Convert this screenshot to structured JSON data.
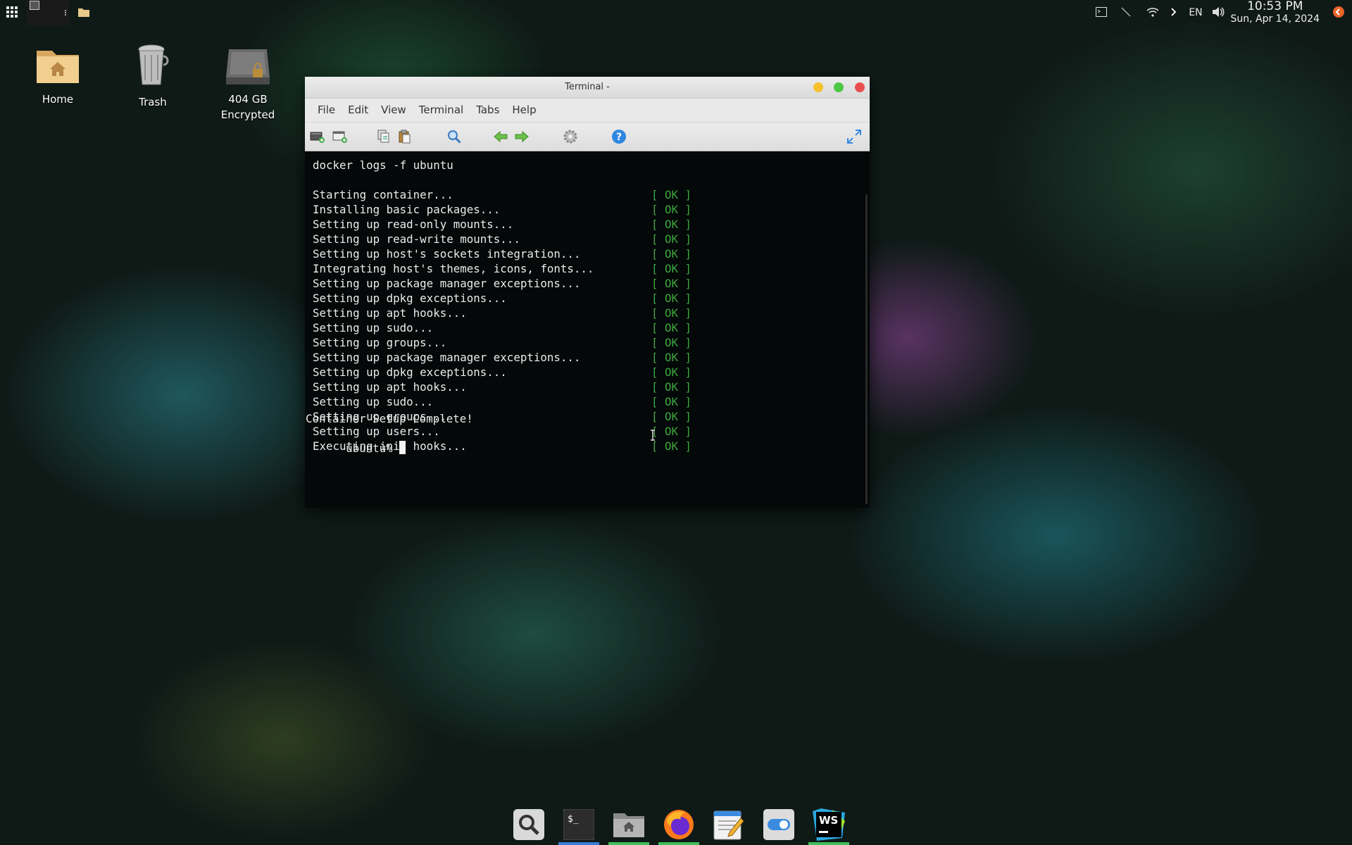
{
  "topbar": {
    "language": "EN",
    "time": "10:53 PM",
    "date": "Sun, Apr 14, 2024",
    "icons": [
      "apps-grid-icon",
      "window-thumbnail-icon",
      "folder-icon",
      "terminal-tray-icon",
      "pen-icon",
      "wifi-icon",
      "chevron-right-icon",
      "volume-icon",
      "power-icon"
    ]
  },
  "desktop": {
    "icons": [
      {
        "name": "Home",
        "sub": ""
      },
      {
        "name": "Trash",
        "sub": ""
      },
      {
        "name": "404 GB",
        "sub": "Encrypted"
      }
    ]
  },
  "terminal": {
    "title": "Terminal -",
    "menu": [
      "File",
      "Edit",
      "View",
      "Terminal",
      "Tabs",
      "Help"
    ],
    "command": "docker logs -f ubuntu",
    "status_label": "[ OK ]",
    "steps": [
      "Starting container...",
      "Installing basic packages...",
      "Setting up read-only mounts...",
      "Setting up read-write mounts...",
      "Setting up host's sockets integration...",
      "Integrating host's themes, icons, fonts...",
      "Setting up package manager exceptions...",
      "Setting up dpkg exceptions...",
      "Setting up apt hooks...",
      "Setting up sudo...",
      "Setting up groups...",
      "Setting up package manager exceptions...",
      "Setting up dpkg exceptions...",
      "Setting up apt hooks...",
      "Setting up sudo...",
      "Setting up groups...",
      "Setting up users...",
      "Executing init hooks..."
    ],
    "complete": "Container Setup Complete!",
    "prompt": "ubuntu% "
  },
  "dock": {
    "items": [
      "search-icon",
      "terminal-icon",
      "home-folder-icon",
      "firefox-icon",
      "text-editor-icon",
      "settings-toggle-icon",
      "webstorm-icon"
    ],
    "ws_label": "WS"
  },
  "colors": {
    "ok_green": "#3ea63e",
    "close_red": "#e94f4f",
    "min_yellow": "#f5c02c",
    "max_green": "#4cc845",
    "dock_blue": "#3a7bd5",
    "dock_green": "#3fbf5a"
  }
}
